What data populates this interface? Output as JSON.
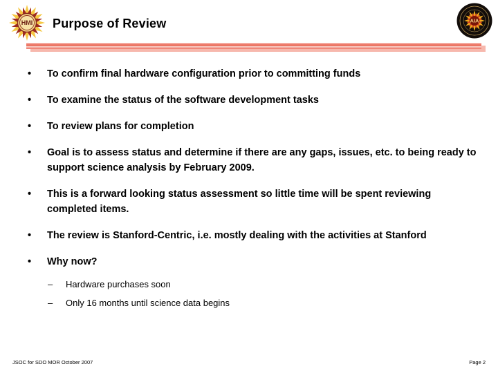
{
  "slide": {
    "title": "Purpose of Review",
    "background_color": "#ffffff",
    "title_color": "#000000"
  },
  "logos": {
    "left": {
      "name": "hmi-logo",
      "text": "HMI",
      "ray_color_light": "#f5c843",
      "ray_color_dark": "#9e2a21",
      "ring_color": "#e8a020"
    },
    "right": {
      "name": "aia-logo",
      "text": "AIA",
      "seal_color": "#1a1410",
      "burst_color": "#f0a81e",
      "accent_color": "#d8431f"
    }
  },
  "divider": {
    "main_color": "#e8614e",
    "highlight_color": "#fbe2dd",
    "shadow_color": "#f7b8ad"
  },
  "bullets": [
    {
      "marker": "•",
      "text": "To confirm final hardware configuration prior to committing funds",
      "level": 1
    },
    {
      "marker": "•",
      "text": "To examine the status of the software development tasks",
      "level": 1
    },
    {
      "marker": "•",
      "text": "To review plans for completion",
      "level": 1
    },
    {
      "marker": "•",
      "text": "Goal is to assess status and determine if there are any gaps, issues, etc. to being ready to support science analysis by February 2009.",
      "level": 1
    },
    {
      "marker": "•",
      "text": "This is a forward looking status assessment so little time will be spent reviewing completed items.",
      "level": 1
    },
    {
      "marker": "•",
      "text": "The review is Stanford-Centric, i.e. mostly dealing with the activities at Stanford",
      "level": 1
    },
    {
      "marker": "•",
      "text": "Why now?",
      "level": 1
    }
  ],
  "subbullets": [
    {
      "marker": "–",
      "text": "Hardware purchases soon",
      "level": 2
    },
    {
      "marker": "–",
      "text": "Only 16 months until science data begins",
      "level": 2
    }
  ],
  "footer": {
    "left": "JSOC for SDO MOR October 2007",
    "right": "Page 2"
  }
}
